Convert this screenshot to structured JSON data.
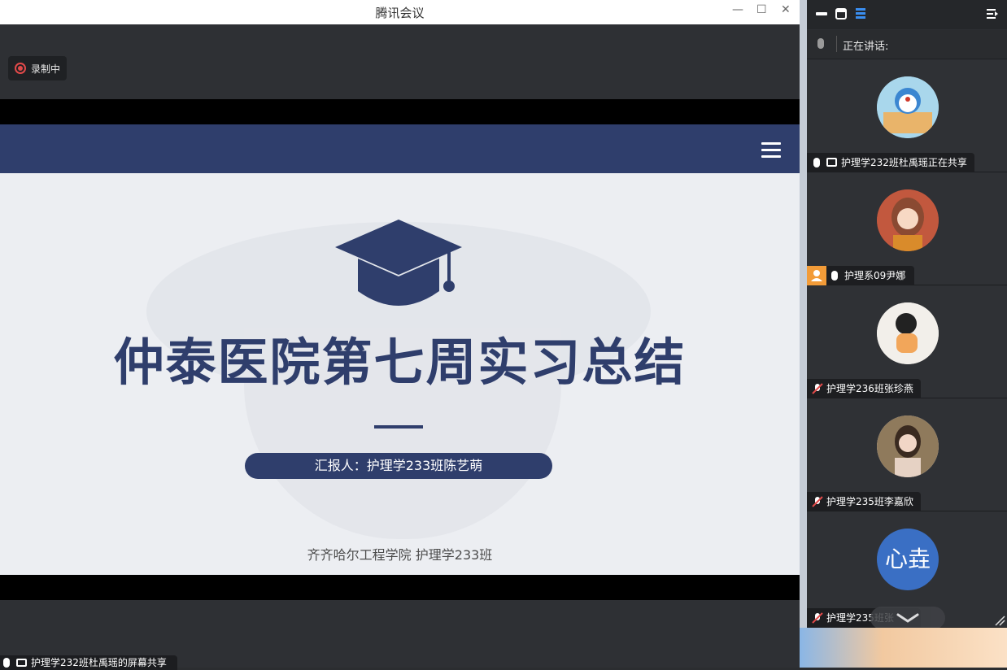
{
  "window": {
    "title": "腾讯会议",
    "controls": {
      "minimize": "—",
      "maximize": "☐",
      "close": "✕"
    }
  },
  "recording": {
    "label": "录制中"
  },
  "slide": {
    "title": "仲泰医院第七周实习总结",
    "presenter": "汇报人：护理学233班陈艺萌",
    "school": "齐齐哈尔工程学院 护理学233班"
  },
  "share_tag": {
    "label": "护理学232班杜禹瑶的屏幕共享"
  },
  "sidebar": {
    "speaking_label": "正在讲话:",
    "participants": [
      {
        "name": "护理学232班杜禹瑶正在共享",
        "mic": "on",
        "sharing": true,
        "avatar": "cartoon-cat"
      },
      {
        "name": "护理系09尹娜",
        "mic": "on",
        "host": true,
        "avatar": "anime-girl"
      },
      {
        "name": "护理学236班张珍燕",
        "mic": "muted",
        "avatar": "chibi-girl"
      },
      {
        "name": "护理学235班李嘉欣",
        "mic": "muted",
        "avatar": "photo-girl"
      },
      {
        "name": "护理学235班张",
        "mic": "muted",
        "avatar_text": "心垚"
      }
    ]
  },
  "colors": {
    "accent": "#2f3e6c",
    "avatar_blue": "#3a6fc4",
    "host_orange": "#f29b38",
    "record_red": "#e24a4a"
  }
}
